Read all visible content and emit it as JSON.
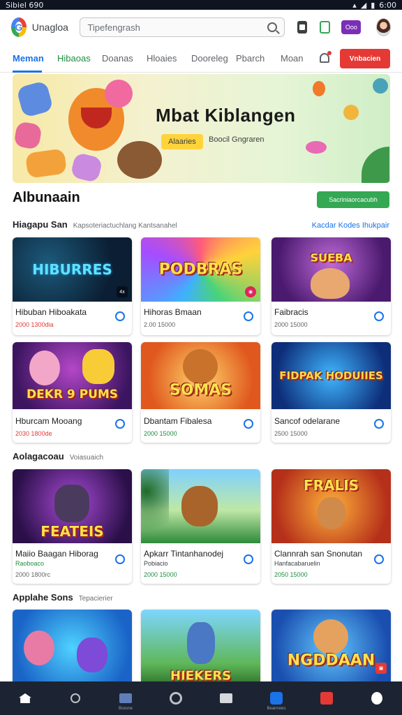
{
  "status_bar": {
    "left": "Sibiel 690",
    "right": "6:00"
  },
  "app_bar": {
    "app_name": "Unagloa",
    "search_placeholder": "Tipefengrash",
    "extra_btn": "Ooo"
  },
  "tabs": [
    {
      "label": "Meman"
    },
    {
      "label": "Hibaoas"
    },
    {
      "label": "Doanas"
    },
    {
      "label": "Hloaies"
    },
    {
      "label": "Dooreleg"
    },
    {
      "label": "Pbarch"
    },
    {
      "label": "Moan"
    }
  ],
  "cta_label": "Vnbacien",
  "hero": {
    "title": "Mbat Kiblangen",
    "badge": "Alaaries",
    "subtitle": "Boocil Gngraren"
  },
  "section1": {
    "title": "Albunaain",
    "button": "Sacriniaorcacubh",
    "sub_heading": "Hiagapu San",
    "sub_desc": "Kapsoteriactuchlang Kantsanahel",
    "link": "Kacdar Kodes Ihukpair"
  },
  "row1": [
    {
      "art": "HIBURRES",
      "name": "Hibuban Hiboakata",
      "meta_a": "2000",
      "meta_b": "1300dia"
    },
    {
      "art": "PODBRAS",
      "name": "Hihoras Bmaan",
      "meta_a": "2.00",
      "meta_b": "15000"
    },
    {
      "art": "SUEBA",
      "name": "Faibracis",
      "meta_a": "2000",
      "meta_b": "15000"
    }
  ],
  "row2": [
    {
      "art": "DEKR 9 PUMS",
      "name": "Hburcam Mooang",
      "meta_a": "2030",
      "meta_b": "1800de"
    },
    {
      "art": "SOMAS",
      "name": "Dbantam Fibalesa",
      "meta_a": "2000",
      "meta_b": "15000"
    },
    {
      "art": "FIDPAK HODUIIES",
      "name": "Sancof odelarane",
      "meta_a": "2500",
      "meta_b": "15000"
    }
  ],
  "section2": {
    "heading": "Aolagacoau",
    "desc": "Voiasuaich"
  },
  "row3": [
    {
      "art": "FEATEIS",
      "name": "Maiio Baagan Hiborag",
      "sub": "Raoboaco",
      "meta_a": "2000",
      "meta_b": "1800rc"
    },
    {
      "art": "",
      "name": "Apkarr Tintanhanodej",
      "sub": "Pobiacio",
      "meta_a": "2000",
      "meta_b": "15000"
    },
    {
      "art": "FRALIS",
      "name": "Clannrah san Snonutan",
      "sub": "Hanfacabaruelin",
      "meta_a": "2050",
      "meta_b": "15000"
    }
  ],
  "section3": {
    "heading": "Applahe Sons",
    "desc": "Tepacierier"
  },
  "row4": [
    {
      "art": ""
    },
    {
      "art": "HIEKERS"
    },
    {
      "art": "NGDDAAN"
    }
  ],
  "bottom_nav": [
    {
      "icon": "home-icon"
    },
    {
      "icon": "search-icon"
    },
    {
      "icon": "grid-icon",
      "label": "Bcesne"
    },
    {
      "icon": "circle-icon"
    },
    {
      "icon": "mail-icon"
    },
    {
      "icon": "q-icon",
      "label": "Beannoes"
    },
    {
      "icon": "red-square-icon"
    },
    {
      "icon": "user-icon"
    }
  ]
}
